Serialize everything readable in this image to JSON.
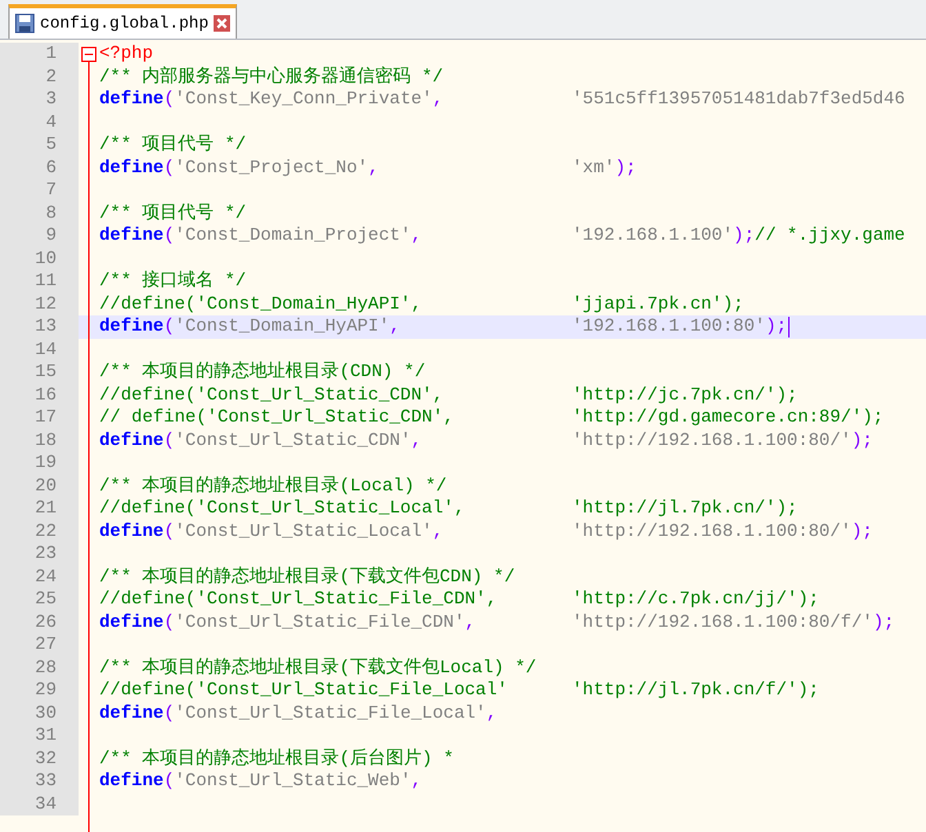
{
  "tab": {
    "title": "config.global.php",
    "selected": true
  },
  "lines": [
    {
      "number": "1",
      "current": false,
      "left": [
        {
          "kind": "tag",
          "text": "<?php"
        }
      ]
    },
    {
      "number": "2",
      "current": false,
      "left": [
        {
          "kind": "comment",
          "text": "/** 内部服务器与中心服务器通信密码 */"
        }
      ]
    },
    {
      "number": "3",
      "current": false,
      "left": [
        {
          "kind": "kw",
          "text": "define"
        },
        {
          "kind": "op",
          "text": "("
        },
        {
          "kind": "str",
          "text": "'Const_Key_Conn_Private'"
        },
        {
          "kind": "op",
          "text": ","
        }
      ],
      "right": [
        {
          "kind": "str",
          "text": "'551c5ff13957051481dab7f3ed5d46"
        }
      ]
    },
    {
      "number": "4",
      "current": false
    },
    {
      "number": "5",
      "current": false,
      "left": [
        {
          "kind": "comment",
          "text": "/** 项目代号 */"
        }
      ]
    },
    {
      "number": "6",
      "current": false,
      "left": [
        {
          "kind": "kw",
          "text": "define"
        },
        {
          "kind": "op",
          "text": "("
        },
        {
          "kind": "str",
          "text": "'Const_Project_No'"
        },
        {
          "kind": "op",
          "text": ","
        }
      ],
      "right": [
        {
          "kind": "str",
          "text": "'xm'"
        },
        {
          "kind": "op",
          "text": ");"
        }
      ]
    },
    {
      "number": "7",
      "current": false
    },
    {
      "number": "8",
      "current": false,
      "left": [
        {
          "kind": "comment",
          "text": "/** 项目代号 */"
        }
      ]
    },
    {
      "number": "9",
      "current": false,
      "left": [
        {
          "kind": "kw",
          "text": "define"
        },
        {
          "kind": "op",
          "text": "("
        },
        {
          "kind": "str",
          "text": "'Const_Domain_Project'"
        },
        {
          "kind": "op",
          "text": ","
        }
      ],
      "right": [
        {
          "kind": "str",
          "text": "'192.168.1.100'"
        },
        {
          "kind": "op",
          "text": ");"
        },
        {
          "kind": "comment",
          "text": "// *.jjxy.game"
        }
      ]
    },
    {
      "number": "10",
      "current": false
    },
    {
      "number": "11",
      "current": false,
      "left": [
        {
          "kind": "comment",
          "text": "/** 接口域名 */"
        }
      ]
    },
    {
      "number": "12",
      "current": false,
      "left": [
        {
          "kind": "comment",
          "text": "//define('Const_Domain_HyAPI',"
        }
      ],
      "right": [
        {
          "kind": "comment",
          "text": "'jjapi.7pk.cn');"
        }
      ]
    },
    {
      "number": "13",
      "current": true,
      "left": [
        {
          "kind": "kw",
          "text": "define"
        },
        {
          "kind": "op",
          "text": "("
        },
        {
          "kind": "str",
          "text": "'Const_Domain_HyAPI'"
        },
        {
          "kind": "op",
          "text": ","
        }
      ],
      "right": [
        {
          "kind": "str",
          "text": "'192.168.1.100:80'"
        },
        {
          "kind": "op",
          "text": ");"
        }
      ]
    },
    {
      "number": "14",
      "current": false
    },
    {
      "number": "15",
      "current": false,
      "left": [
        {
          "kind": "comment",
          "text": "/** 本项目的静态地址根目录(CDN) */"
        }
      ]
    },
    {
      "number": "16",
      "current": false,
      "left": [
        {
          "kind": "comment",
          "text": "//define('Const_Url_Static_CDN',"
        }
      ],
      "right": [
        {
          "kind": "comment",
          "text": "'http://jc.7pk.cn/');"
        }
      ]
    },
    {
      "number": "17",
      "current": false,
      "left": [
        {
          "kind": "comment",
          "text": "// define('Const_Url_Static_CDN',"
        }
      ],
      "right": [
        {
          "kind": "comment",
          "text": "'http://gd.gamecore.cn:89/');"
        }
      ]
    },
    {
      "number": "18",
      "current": false,
      "left": [
        {
          "kind": "kw",
          "text": "define"
        },
        {
          "kind": "op",
          "text": "("
        },
        {
          "kind": "str",
          "text": "'Const_Url_Static_CDN'"
        },
        {
          "kind": "op",
          "text": ","
        }
      ],
      "right": [
        {
          "kind": "str",
          "text": "'http://192.168.1.100:80/'"
        },
        {
          "kind": "op",
          "text": ");"
        }
      ]
    },
    {
      "number": "19",
      "current": false
    },
    {
      "number": "20",
      "current": false,
      "left": [
        {
          "kind": "comment",
          "text": "/** 本项目的静态地址根目录(Local) */"
        }
      ]
    },
    {
      "number": "21",
      "current": false,
      "left": [
        {
          "kind": "comment",
          "text": "//define('Const_Url_Static_Local',"
        }
      ],
      "right": [
        {
          "kind": "comment",
          "text": "'http://jl.7pk.cn/');"
        }
      ]
    },
    {
      "number": "22",
      "current": false,
      "left": [
        {
          "kind": "kw",
          "text": "define"
        },
        {
          "kind": "op",
          "text": "("
        },
        {
          "kind": "str",
          "text": "'Const_Url_Static_Local'"
        },
        {
          "kind": "op",
          "text": ","
        }
      ],
      "right": [
        {
          "kind": "str",
          "text": "'http://192.168.1.100:80/'"
        },
        {
          "kind": "op",
          "text": ");"
        }
      ]
    },
    {
      "number": "23",
      "current": false
    },
    {
      "number": "24",
      "current": false,
      "left": [
        {
          "kind": "comment",
          "text": "/** 本项目的静态地址根目录(下载文件包CDN) */"
        }
      ]
    },
    {
      "number": "25",
      "current": false,
      "left": [
        {
          "kind": "comment",
          "text": "//define('Const_Url_Static_File_CDN',"
        }
      ],
      "right": [
        {
          "kind": "comment",
          "text": "'http://c.7pk.cn/jj/');"
        }
      ]
    },
    {
      "number": "26",
      "current": false,
      "left": [
        {
          "kind": "kw",
          "text": "define"
        },
        {
          "kind": "op",
          "text": "("
        },
        {
          "kind": "str",
          "text": "'Const_Url_Static_File_CDN'"
        },
        {
          "kind": "op",
          "text": ","
        }
      ],
      "right": [
        {
          "kind": "str",
          "text": "'http://192.168.1.100:80/f/'"
        },
        {
          "kind": "op",
          "text": ");"
        }
      ]
    },
    {
      "number": "27",
      "current": false
    },
    {
      "number": "28",
      "current": false,
      "left": [
        {
          "kind": "comment",
          "text": "/** 本项目的静态地址根目录(下载文件包Local) */"
        }
      ]
    },
    {
      "number": "29",
      "current": false,
      "left": [
        {
          "kind": "comment",
          "text": "//define('Const_Url_Static_File_Local'"
        }
      ],
      "right": [
        {
          "kind": "comment",
          "text": "'http://jl.7pk.cn/f/');"
        }
      ]
    },
    {
      "number": "30",
      "current": false,
      "left": [
        {
          "kind": "kw",
          "text": "define"
        },
        {
          "kind": "op",
          "text": "("
        },
        {
          "kind": "str",
          "text": "'Const_Url_Static_File_Local'"
        },
        {
          "kind": "op",
          "text": ","
        }
      ]
    },
    {
      "number": "31",
      "current": false
    },
    {
      "number": "32",
      "current": false,
      "left": [
        {
          "kind": "comment",
          "text": "/** 本项目的静态地址根目录(后台图片) *"
        }
      ]
    },
    {
      "number": "33",
      "current": false,
      "left": [
        {
          "kind": "kw",
          "text": "define"
        },
        {
          "kind": "op",
          "text": "("
        },
        {
          "kind": "str",
          "text": "'Const_Url_Static_Web'"
        },
        {
          "kind": "op",
          "text": ","
        }
      ]
    },
    {
      "number": "34",
      "current": false
    }
  ]
}
